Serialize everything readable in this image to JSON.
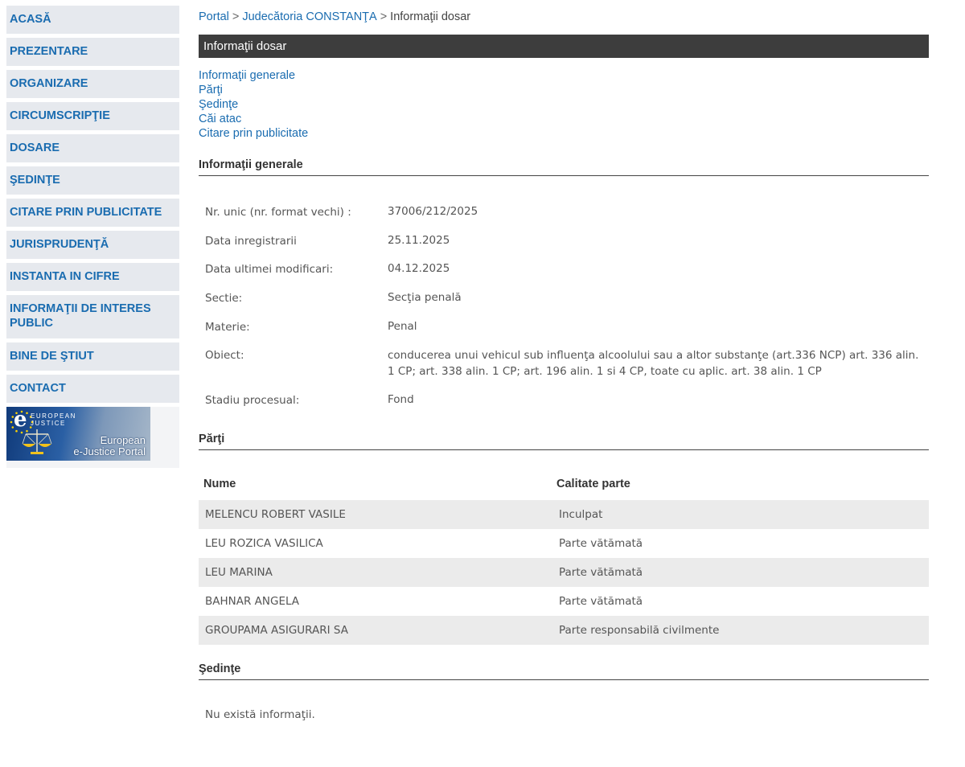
{
  "sidebar": {
    "items": [
      {
        "label": "ACASĂ"
      },
      {
        "label": "PREZENTARE"
      },
      {
        "label": "ORGANIZARE"
      },
      {
        "label": "CIRCUMSCRIPŢIE"
      },
      {
        "label": "DOSARE"
      },
      {
        "label": "ŞEDINŢE"
      },
      {
        "label": "CITARE PRIN PUBLICITATE"
      },
      {
        "label": "JURISPRUDENŢĂ"
      },
      {
        "label": "INSTANTA IN CIFRE"
      },
      {
        "label": "INFORMAŢII DE INTERES PUBLIC"
      },
      {
        "label": "BINE DE ŞTIUT"
      },
      {
        "label": "CONTACT"
      }
    ],
    "banner": {
      "logo_e": "e",
      "logo_line1": "EUROPEAN",
      "logo_line2": "JUSTICE",
      "title_line1": "European",
      "title_line2": "e-Justice Portal"
    }
  },
  "breadcrumb": {
    "items": [
      "Portal",
      "Judecătoria CONSTANŢA",
      "Informaţii dosar"
    ],
    "separator": ">"
  },
  "header": {
    "title": "Informaţii dosar"
  },
  "anchors": [
    "Informaţii generale",
    "Părţi",
    "Şedinţe",
    "Căi atac",
    "Citare prin publicitate"
  ],
  "general": {
    "title": "Informaţii generale",
    "rows": [
      {
        "label": "Nr. unic (nr. format vechi) :",
        "value": "37006/212/2025"
      },
      {
        "label": "Data inregistrarii",
        "value": "25.11.2025"
      },
      {
        "label": "Data ultimei modificari:",
        "value": "04.12.2025"
      },
      {
        "label": "Sectie:",
        "value": "Secţia penală"
      },
      {
        "label": "Materie:",
        "value": "Penal"
      },
      {
        "label": "Obiect:",
        "value": "conducerea unui vehicul sub influenţa alcoolului sau a altor substanţe (art.336 NCP) art. 336 alin. 1 CP; art. 338 alin. 1 CP; art. 196 alin. 1 si 4 CP, toate cu aplic. art. 38 alin. 1 CP"
      },
      {
        "label": "Stadiu procesual:",
        "value": "Fond"
      }
    ]
  },
  "parti": {
    "title": "Părţi",
    "columns": [
      "Nume",
      "Calitate parte"
    ],
    "rows": [
      {
        "name": "MELENCU ROBERT VASILE",
        "role": "Inculpat"
      },
      {
        "name": "LEU ROZICA VASILICA",
        "role": "Parte vătămată"
      },
      {
        "name": "LEU MARINA",
        "role": "Parte vătămată"
      },
      {
        "name": "BAHNAR ANGELA",
        "role": "Parte vătămată"
      },
      {
        "name": "GROUPAMA ASIGURARI SA",
        "role": "Parte responsabilă civilmente"
      }
    ]
  },
  "sedinte": {
    "title": "Şedinţe",
    "empty_text": "Nu există informaţii."
  },
  "colors": {
    "link": "#1a6cb0",
    "nav_bg": "#e6e9ee",
    "header_bg": "#3d3d3d",
    "row_alt": "#ebebeb"
  }
}
